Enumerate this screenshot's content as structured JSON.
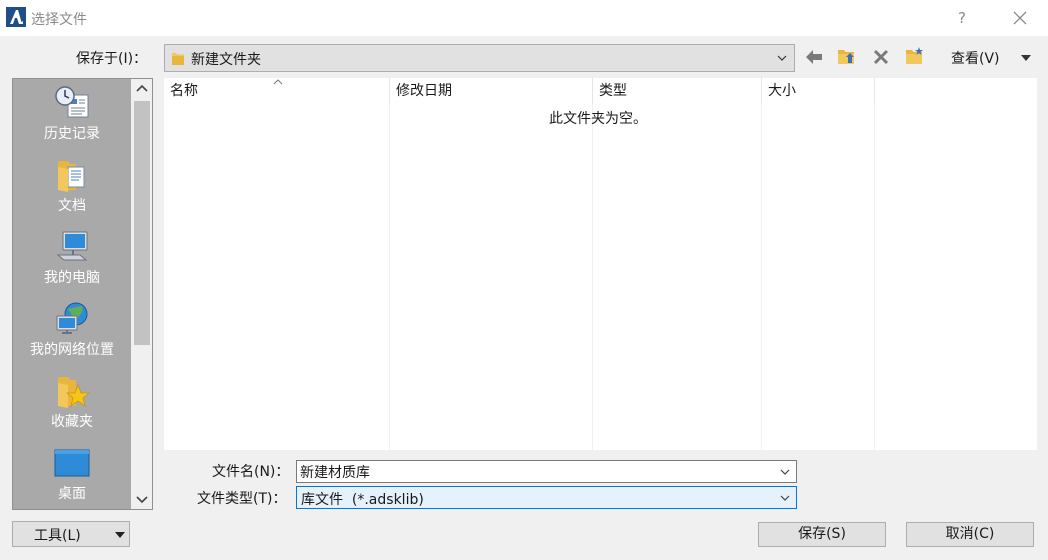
{
  "window": {
    "title": "选择文件",
    "help_glyph": "?"
  },
  "toolbar": {
    "save_in_label": "保存于(I)：",
    "save_in_value": "新建文件夹",
    "view_label": "查看(V)"
  },
  "places": [
    {
      "label": "历史记录",
      "icon": "history-icon"
    },
    {
      "label": "文档",
      "icon": "documents-folder-icon"
    },
    {
      "label": "我的电脑",
      "icon": "computer-icon"
    },
    {
      "label": "我的网络位置",
      "icon": "network-icon"
    },
    {
      "label": "收藏夹",
      "icon": "favorites-folder-icon"
    },
    {
      "label": "桌面",
      "icon": "desktop-icon"
    }
  ],
  "file_list": {
    "columns": [
      "名称",
      "修改日期",
      "类型",
      "大小"
    ],
    "empty_message": "此文件夹为空。"
  },
  "form": {
    "file_name_label": "文件名(N)：",
    "file_name_value": "新建材质库",
    "file_type_label": "文件类型(T)：",
    "file_type_value": "库文件  (*.adsklib)"
  },
  "buttons": {
    "tools": "工具(L)",
    "save": "保存(S)",
    "cancel": "取消(C)"
  },
  "colors": {
    "places_background": "#a9a9a9",
    "folder_yellow": "#f2c75c",
    "selection_blue": "#0078d7"
  }
}
